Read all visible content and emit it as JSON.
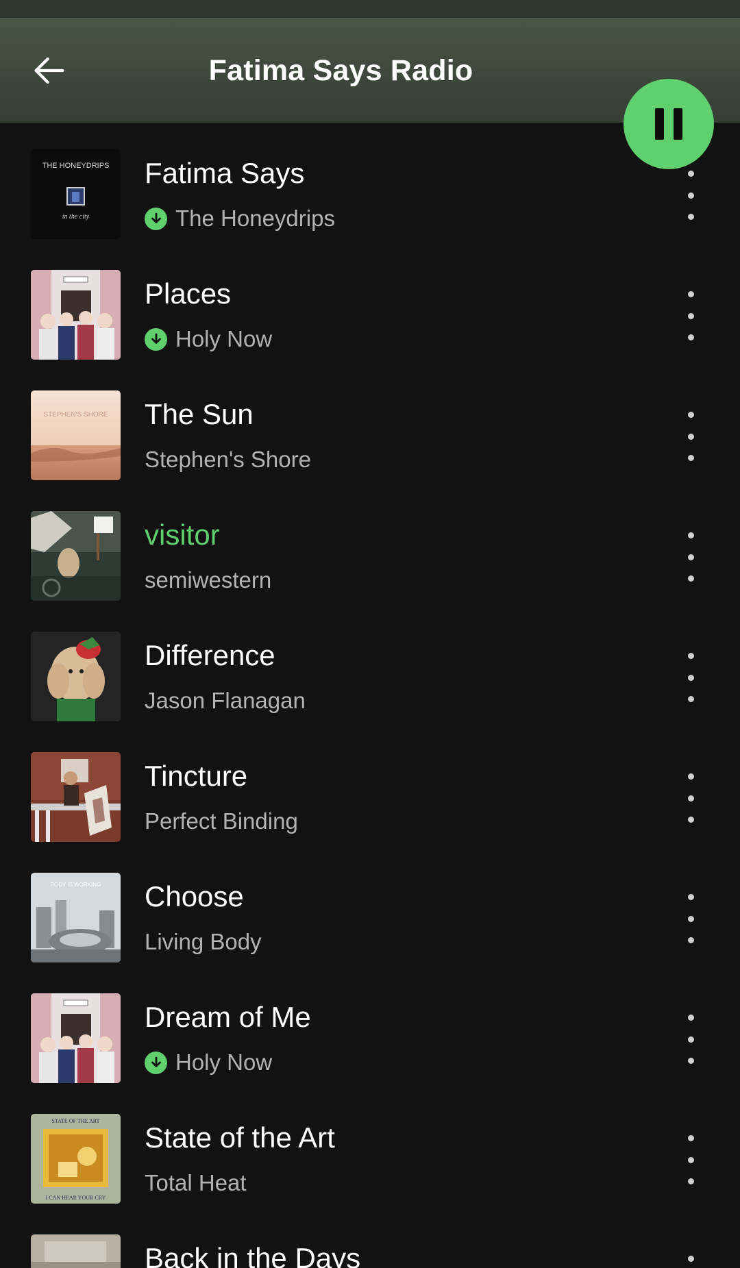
{
  "header": {
    "title": "Fatima Says Radio",
    "back_icon": "arrow-left-icon",
    "pause_icon": "pause-icon"
  },
  "colors": {
    "accent": "#5fd06d",
    "background": "#121212",
    "header_bg": "#3d463b"
  },
  "tracks": [
    {
      "title": "Fatima Says",
      "artist": "The Honeydrips",
      "downloaded": true,
      "playing": false,
      "art_text": "THE HONEYDRIPS",
      "art_subtext": "in the city"
    },
    {
      "title": "Places",
      "artist": "Holy Now",
      "downloaded": true,
      "playing": false
    },
    {
      "title": "The Sun",
      "artist": "Stephen's Shore",
      "downloaded": false,
      "playing": false,
      "art_text": "STEPHEN'S SHORE"
    },
    {
      "title": "visitor",
      "artist": "semiwestern",
      "downloaded": false,
      "playing": true
    },
    {
      "title": "Difference",
      "artist": "Jason Flanagan",
      "downloaded": false,
      "playing": false
    },
    {
      "title": "Tincture",
      "artist": "Perfect Binding",
      "downloaded": false,
      "playing": false
    },
    {
      "title": "Choose",
      "artist": "Living Body",
      "downloaded": false,
      "playing": false,
      "art_text": "BODY IS WORKING"
    },
    {
      "title": "Dream of Me",
      "artist": "Holy Now",
      "downloaded": true,
      "playing": false
    },
    {
      "title": "State of the Art",
      "artist": "Total Heat",
      "downloaded": false,
      "playing": false,
      "art_text": "STATE OF THE ART",
      "art_subtext": "I CAN HEAR YOUR CRY"
    },
    {
      "title": "Back in the Days",
      "artist": "",
      "downloaded": false,
      "playing": false
    }
  ]
}
